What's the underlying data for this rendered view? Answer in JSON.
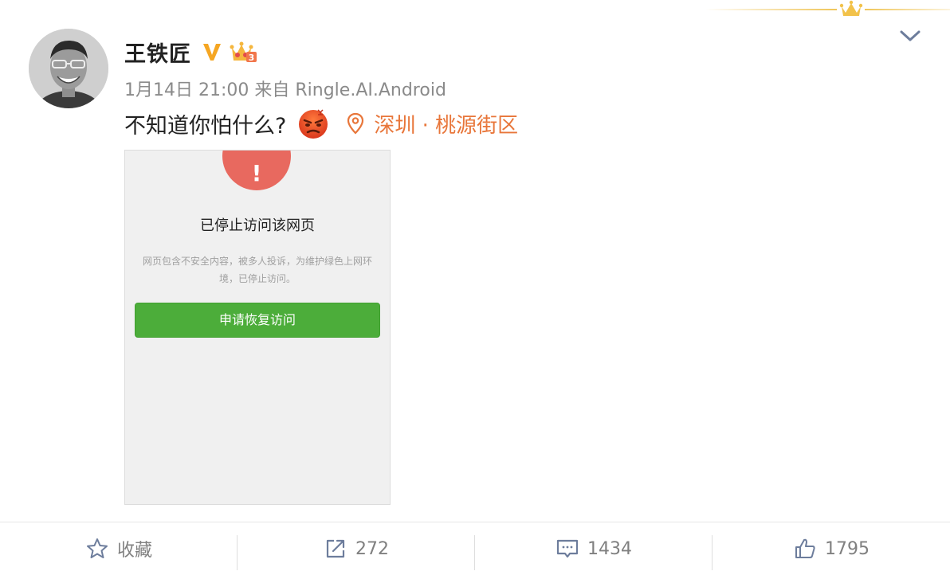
{
  "post": {
    "username": "王铁匠",
    "meta": "1月14日 21:00 来自 Ringle.AI.Android",
    "text": "不知道你怕什么?",
    "location": "深圳 · 桃源街区",
    "emoji_icon": "angry-face-icon",
    "vip_level": "3"
  },
  "screenshot": {
    "title": "已停止访问该网页",
    "description": "网页包含不安全内容，被多人投诉，为维护绿色上网环境，已停止访问。",
    "button_label": "申请恢复访问",
    "warning_color": "#e8695f",
    "button_color": "#4cad3a"
  },
  "actions": {
    "favorite_label": "收藏",
    "repost_count": "272",
    "comment_count": "1434",
    "like_count": "1795"
  },
  "colors": {
    "location": "#e8763a",
    "verified": "#f5a623",
    "crown": "#f0c65a"
  }
}
